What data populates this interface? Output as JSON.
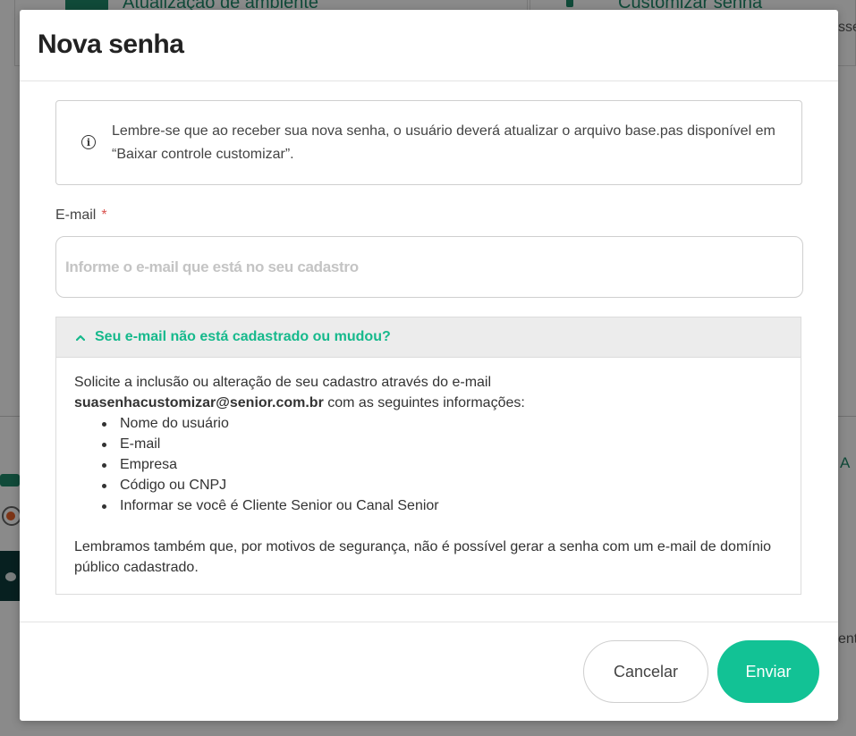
{
  "background": {
    "card1_title": "Atualização de ambiente",
    "card2_title": "Customizar senha",
    "right_fragment_1": "sse",
    "right_fragment_2": "A",
    "right_fragment_3": "ent"
  },
  "modal": {
    "title": "Nova senha",
    "info": {
      "icon": "info-icon",
      "text": "Lembre-se que ao receber sua nova senha, o usuário deverá atualizar o arquivo base.pas disponível em “Baixar controle customizar”."
    },
    "email_field": {
      "label": "E-mail",
      "required_mark": "*",
      "value": "",
      "placeholder": "Informe o e-mail que está no seu cadastro"
    },
    "accordion": {
      "icon": "chevron-up-icon",
      "title": "Seu e-mail não está cadastrado ou mudou?",
      "intro": "Solicite a inclusão ou alteração de seu cadastro através do e-mail",
      "email": "suasenhacustomizar@senior.com.br",
      "intro_suffix": " com as seguintes informações:",
      "items": [
        "Nome do usuário",
        "E-mail",
        "Empresa",
        "Código ou CNPJ",
        "Informar se você é Cliente Senior ou Canal Senior"
      ],
      "note": "Lembramos também que, por motivos de segurança, não é possível gerar a senha com um e-mail de domínio público cadastrado."
    },
    "footer": {
      "cancel_label": "Cancelar",
      "send_label": "Enviar"
    }
  },
  "colors": {
    "accent": "#12c295",
    "accordion_title": "#16b98c",
    "required": "#d9534f"
  }
}
